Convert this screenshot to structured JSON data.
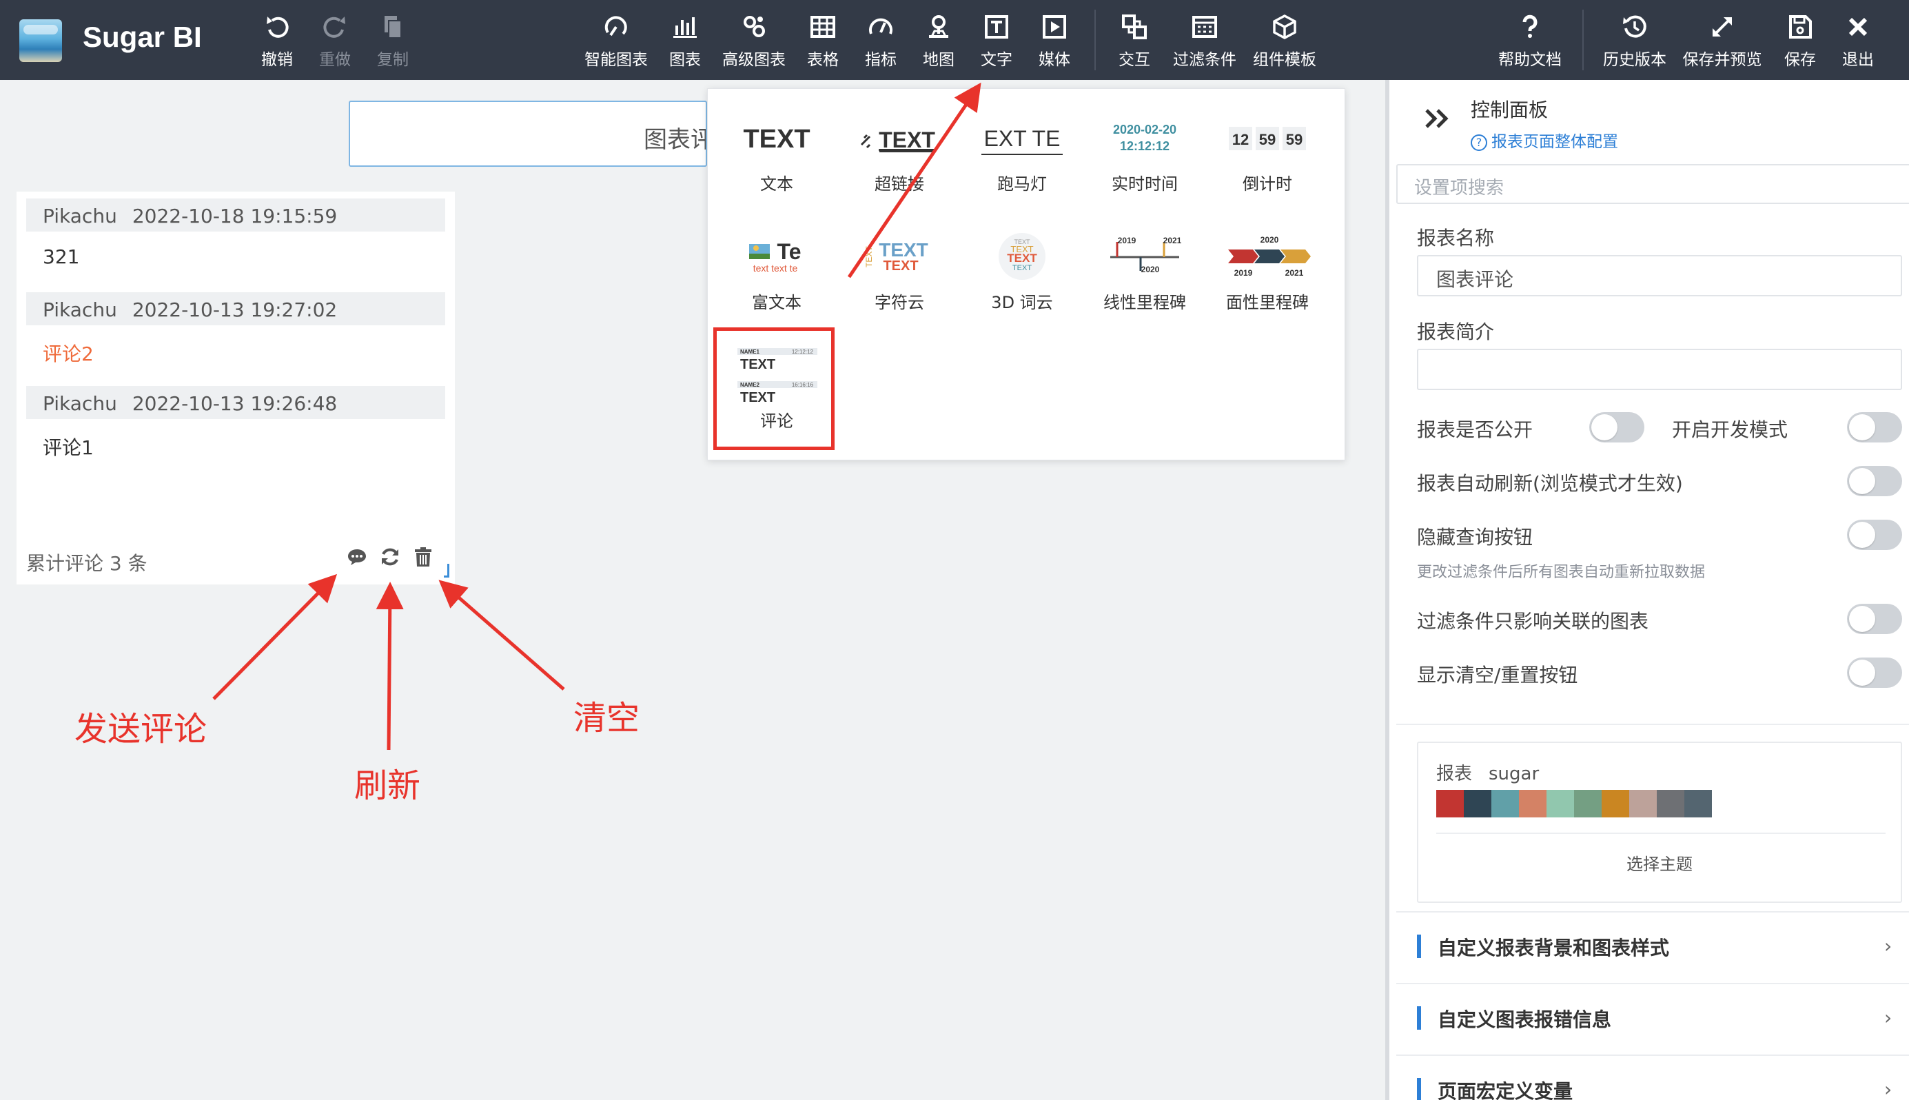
{
  "app": {
    "brand": "Sugar BI"
  },
  "toolbar": {
    "undo": "撤销",
    "redo": "重做",
    "copy": "复制",
    "smart_chart": "智能图表",
    "chart": "图表",
    "advanced_chart": "高级图表",
    "table": "表格",
    "indicator": "指标",
    "map": "地图",
    "text": "文字",
    "media": "媒体",
    "interaction": "交互",
    "filter": "过滤条件",
    "component_template": "组件模板",
    "help": "帮助文档",
    "history": "历史版本",
    "save_preview": "保存并预览",
    "save": "保存",
    "exit": "退出"
  },
  "canvas": {
    "title_text": "图表评论",
    "comments": [
      {
        "user": "Pikachu",
        "time": "2022-10-18 19:15:59",
        "text": "321"
      },
      {
        "user": "Pikachu",
        "time": "2022-10-13 19:27:02",
        "text": "评论2"
      },
      {
        "user": "Pikachu",
        "time": "2022-10-13 19:26:48",
        "text": "评论1"
      }
    ],
    "count_text": "累计评论 3 条"
  },
  "dropdown": {
    "items": [
      {
        "name": "文本",
        "preview": "TEXT"
      },
      {
        "name": "超链接",
        "preview": "TEXT"
      },
      {
        "name": "跑马灯",
        "preview": "EXT TE"
      },
      {
        "name": "实时时间",
        "preview_date": "2020-02-20",
        "preview_time": "12:12:12"
      },
      {
        "name": "倒计时",
        "preview_digits": [
          "12",
          "59",
          "59"
        ]
      },
      {
        "name": "富文本",
        "preview": "Te",
        "preview_sub": "text text te"
      },
      {
        "name": "字符云",
        "preview": "TEXT"
      },
      {
        "name": "3D 词云",
        "preview": "TEXT"
      },
      {
        "name": "线性里程碑",
        "preview_years": [
          "2019",
          "2021",
          "2020"
        ]
      },
      {
        "name": "面性里程碑",
        "preview_years": [
          "2020",
          "2019",
          "2021"
        ]
      },
      {
        "name": "评论",
        "preview_rows": [
          {
            "name": "NAME1",
            "time": "12:12:12",
            "text": "TEXT"
          },
          {
            "name": "NAME2",
            "time": "16:16:16",
            "text": "TEXT"
          }
        ]
      }
    ]
  },
  "panel": {
    "title": "控制面板",
    "config_link": "报表页面整体配置",
    "search_placeholder": "设置项搜索",
    "report_name_label": "报表名称",
    "report_name_value": "图表评论",
    "report_desc_label": "报表简介",
    "public_label": "报表是否公开",
    "dev_mode_label": "开启开发模式",
    "auto_refresh_label": "报表自动刷新(浏览模式才生效)",
    "hide_query_label": "隐藏查询按钮",
    "hide_query_hint": "更改过滤条件后所有图表自动重新拉取数据",
    "filter_related_label": "过滤条件只影响关联的图表",
    "show_reset_label": "显示清空/重置按钮",
    "toggles": {
      "public": false,
      "dev_mode": false,
      "auto_refresh": false,
      "hide_query": false,
      "filter_related": false,
      "show_reset": false
    },
    "theme": {
      "label": "报表",
      "name": "sugar",
      "select_label": "选择主题",
      "colors": [
        "#c23531",
        "#2f4554",
        "#61a0a8",
        "#d48265",
        "#91c7ae",
        "#749f83",
        "#ca8622",
        "#bda29a",
        "#6e7074",
        "#546570"
      ]
    },
    "sections": [
      "自定义报表背景和图表样式",
      "自定义图表报错信息",
      "页面宏定义变量"
    ]
  },
  "annotations": {
    "send": "发送评论",
    "refresh": "刷新",
    "clear": "清空"
  },
  "colors": {
    "topbar": "#333a47",
    "accent": "#2d7fd6",
    "annotation": "#e8332b",
    "highlight_comment": "#ef6b3b"
  }
}
